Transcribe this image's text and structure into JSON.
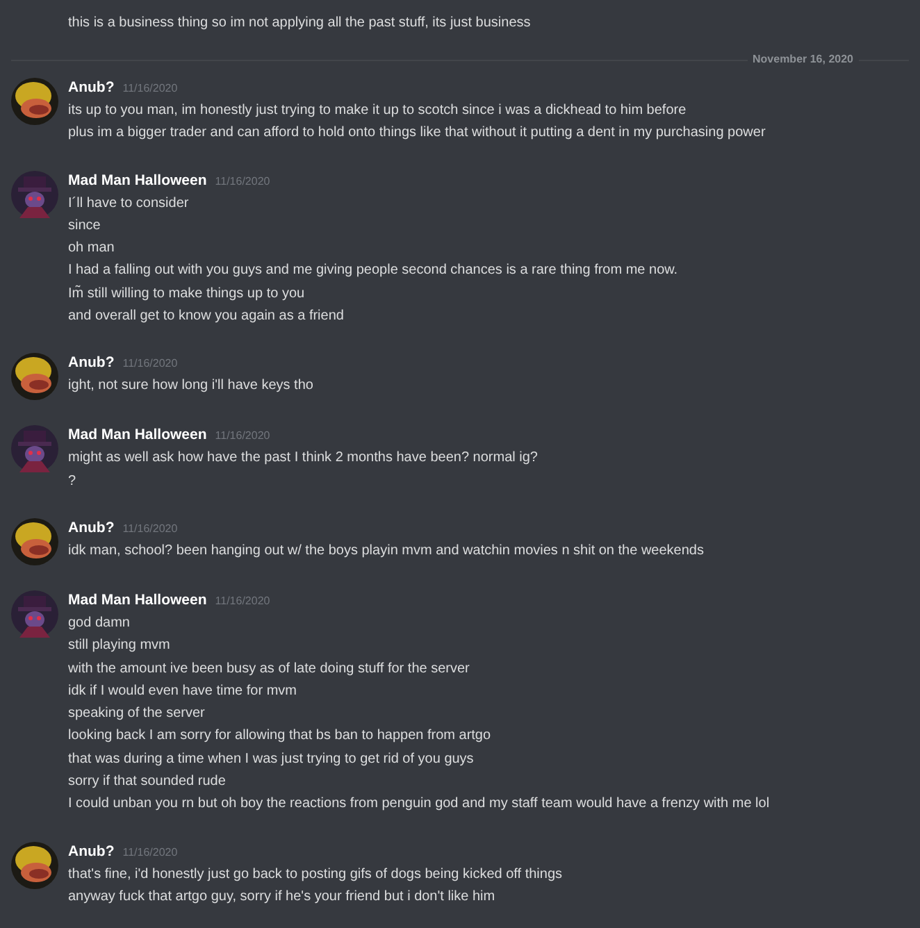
{
  "top_message": {
    "lines": [
      "this is a business thing so im not applying all the past stuff, its just business"
    ]
  },
  "date_divider": "November 16, 2020",
  "messages": [
    {
      "author": "Anub?",
      "time": "11/16/2020",
      "avatar": {
        "kind": "duck"
      },
      "lines": [
        "its up to you man, im honestly just trying to make it up to scotch since i was a dickhead to him before",
        "plus im a bigger trader and can afford to hold onto things like that without it putting a dent in my purchasing power"
      ]
    },
    {
      "author": "Mad Man Halloween",
      "time": "11/16/2020",
      "avatar": {
        "kind": "villain"
      },
      "lines": [
        "I´ll have to consider",
        "since",
        "oh man",
        "I had a falling out with you guys and me giving people second chances is a rare thing from me now.",
        "Im̃ still willing to make things up to you",
        "and overall get to know you again as a friend"
      ]
    },
    {
      "author": "Anub?",
      "time": "11/16/2020",
      "avatar": {
        "kind": "duck"
      },
      "lines": [
        "ight, not sure how long i'll have keys tho"
      ]
    },
    {
      "author": "Mad Man Halloween",
      "time": "11/16/2020",
      "avatar": {
        "kind": "villain"
      },
      "lines": [
        "might as well ask how have the past I think 2 months have been? normal ig?",
        "?"
      ]
    },
    {
      "author": "Anub?",
      "time": "11/16/2020",
      "avatar": {
        "kind": "duck"
      },
      "lines": [
        "idk man, school? been hanging out w/ the boys playin mvm and watchin movies n shit on the weekends"
      ]
    },
    {
      "author": "Mad Man Halloween",
      "time": "11/16/2020",
      "avatar": {
        "kind": "villain"
      },
      "lines": [
        "god damn",
        "still playing mvm",
        "with the amount ive been busy as of late doing stuff for the server",
        "idk if I would even have time for mvm",
        "speaking of the server",
        "looking back I am sorry for allowing that bs ban to happen from artgo",
        "that was during a time when I was just trying to get rid of you guys",
        "sorry if that sounded rude",
        "I could unban you rn but oh boy the reactions from penguin god and my staff team would have a frenzy with me lol"
      ]
    },
    {
      "author": "Anub?",
      "time": "11/16/2020",
      "avatar": {
        "kind": "duck"
      },
      "lines": [
        "that's fine, i'd honestly just go back to posting gifs of dogs being kicked off things",
        "anyway fuck that artgo guy, sorry if he's your friend but i don't like him"
      ]
    }
  ]
}
